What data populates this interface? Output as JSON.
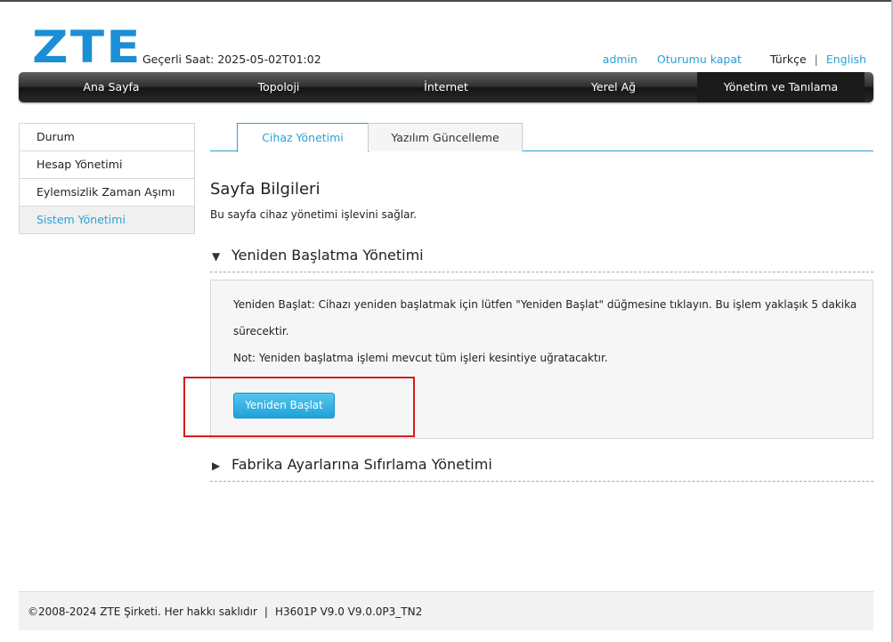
{
  "header": {
    "logo_text": "ZTE",
    "time_label": "Geçerli Saat: 2025-05-02T01:02",
    "user": "admin",
    "logout": "Oturumu kapat",
    "lang_current": "Türkçe",
    "lang_separator": "|",
    "lang_other": "English"
  },
  "nav": {
    "items": [
      {
        "label": "Ana Sayfa"
      },
      {
        "label": "Topoloji"
      },
      {
        "label": "İnternet"
      },
      {
        "label": "Yerel Ağ"
      },
      {
        "label": "Yönetim ve Tanılama",
        "active": true
      }
    ]
  },
  "sidebar": {
    "items": [
      {
        "label": "Durum"
      },
      {
        "label": "Hesap Yönetimi"
      },
      {
        "label": "Eylemsizlik Zaman Aşımı"
      },
      {
        "label": "Sistem Yönetimi",
        "active": true
      }
    ]
  },
  "tabs": [
    {
      "label": "Cihaz Yönetimi",
      "active": true
    },
    {
      "label": "Yazılım Güncelleme"
    }
  ],
  "page": {
    "title": "Sayfa Bilgileri",
    "description": "Bu sayfa cihaz yönetimi işlevini sağlar."
  },
  "reboot": {
    "title": "Yeniden Başlatma Yönetimi",
    "expanded": true,
    "text_line1": "Yeniden Başlat: Cihazı yeniden başlatmak için lütfen \"Yeniden Başlat\" düğmesine tıklayın. Bu işlem yaklaşık 5 dakika",
    "text_line2": "sürecektir.",
    "note": "Not: Yeniden başlatma işlemi mevcut tüm işleri kesintiye uğratacaktır.",
    "button_label": "Yeniden Başlat"
  },
  "factory": {
    "title": "Fabrika Ayarlarına Sıfırlama Yönetimi",
    "expanded": false
  },
  "footer": {
    "copyright": "©2008-2024 ZTE Şirketi. Her hakkı saklıdır",
    "separator": "|",
    "version": "H3601P V9.0 V9.0.0P3_TN2"
  },
  "colors": {
    "accent": "#2aa0d8",
    "logo": "#1b8fd6",
    "highlight": "#d81b1b",
    "button": "#1ea2d9"
  },
  "icons": {
    "expanded": "triangle-down-icon",
    "collapsed": "triangle-right-icon"
  }
}
